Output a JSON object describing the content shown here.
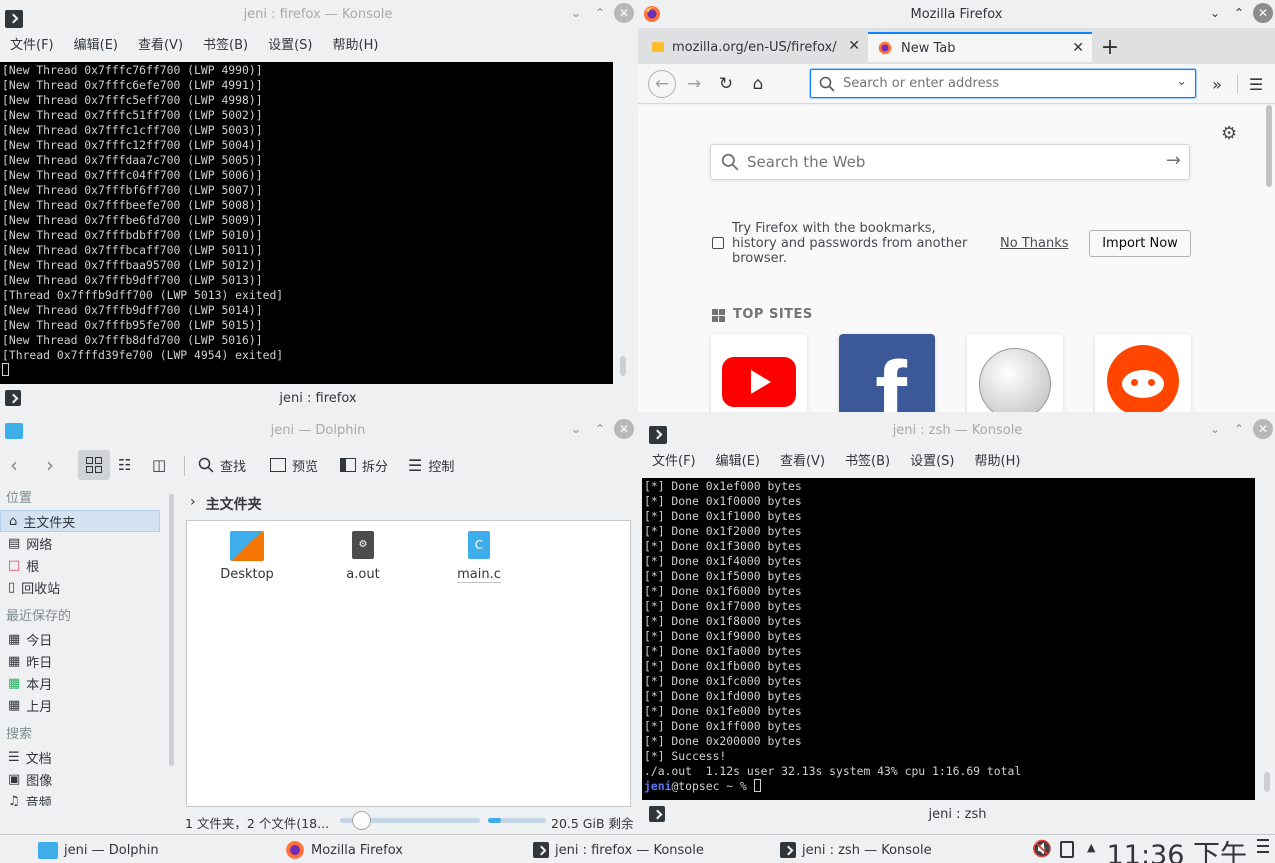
{
  "konsole_top": {
    "title": "jeni : firefox — Konsole",
    "menu": [
      "文件(F)",
      "编辑(E)",
      "查看(V)",
      "书签(B)",
      "设置(S)",
      "帮助(H)"
    ],
    "lines": [
      "[New Thread 0x7fffc76ff700 (LWP 4990)]",
      "[New Thread 0x7fffc6efe700 (LWP 4991)]",
      "[New Thread 0x7fffc5eff700 (LWP 4998)]",
      "[New Thread 0x7fffc51ff700 (LWP 5002)]",
      "[New Thread 0x7fffc1cff700 (LWP 5003)]",
      "[New Thread 0x7fffc12ff700 (LWP 5004)]",
      "[New Thread 0x7fffdaa7c700 (LWP 5005)]",
      "[New Thread 0x7fffc04ff700 (LWP 5006)]",
      "[New Thread 0x7fffbf6ff700 (LWP 5007)]",
      "[New Thread 0x7fffbeefe700 (LWP 5008)]",
      "[New Thread 0x7fffbe6fd700 (LWP 5009)]",
      "[New Thread 0x7fffbdbff700 (LWP 5010)]",
      "[New Thread 0x7fffbcaff700 (LWP 5011)]",
      "[New Thread 0x7fffbaa95700 (LWP 5012)]",
      "[New Thread 0x7fffb9dff700 (LWP 5013)]",
      "[Thread 0x7fffb9dff700 (LWP 5013) exited]",
      "[New Thread 0x7fffb9dff700 (LWP 5014)]",
      "[New Thread 0x7fffb95fe700 (LWP 5015)]",
      "[New Thread 0x7fffb8dfd700 (LWP 5016)]",
      "[Thread 0x7fffd39fe700 (LWP 4954) exited]"
    ],
    "tab_label": "jeni : firefox"
  },
  "firefox": {
    "title": "Mozilla Firefox",
    "tabs": [
      "mozilla.org/en-US/firefox/",
      "New Tab"
    ],
    "url_placeholder": "Search or enter address",
    "web_search_placeholder": "Search the Web",
    "import_text": "Try Firefox with the bookmarks, history and passwords from another browser.",
    "no_thanks": "No Thanks",
    "import_now": "Import Now",
    "top_sites_label": "TOP SITES",
    "top_sites": [
      "youtube",
      "facebook",
      "wikipedia",
      "reddit"
    ]
  },
  "dolphin": {
    "title": "jeni — Dolphin",
    "toolbar": {
      "find": "查找",
      "preview": "预览",
      "split": "拆分",
      "control": "控制"
    },
    "breadcrumb": "主文件夹",
    "places": {
      "header_places": "位置",
      "items_places": [
        "主文件夹",
        "网络",
        "根",
        "回收站"
      ],
      "header_recent": "最近保存的",
      "items_recent": [
        "今日",
        "昨日",
        "本月",
        "上月"
      ],
      "header_search": "搜索",
      "items_search": [
        "文档",
        "图像",
        "音频"
      ]
    },
    "files": [
      "Desktop",
      "a.out",
      "main.c"
    ],
    "status": "1 文件夹，2 个文件(18...",
    "free_space": "20.5 GiB 剩余"
  },
  "konsole_bottom": {
    "title": "jeni : zsh — Konsole",
    "menu": [
      "文件(F)",
      "编辑(E)",
      "查看(V)",
      "书签(B)",
      "设置(S)",
      "帮助(H)"
    ],
    "lines": [
      "[*] Done 0x1ef000 bytes",
      "[*] Done 0x1f0000 bytes",
      "[*] Done 0x1f1000 bytes",
      "[*] Done 0x1f2000 bytes",
      "[*] Done 0x1f3000 bytes",
      "[*] Done 0x1f4000 bytes",
      "[*] Done 0x1f5000 bytes",
      "[*] Done 0x1f6000 bytes",
      "[*] Done 0x1f7000 bytes",
      "[*] Done 0x1f8000 bytes",
      "[*] Done 0x1f9000 bytes",
      "[*] Done 0x1fa000 bytes",
      "[*] Done 0x1fb000 bytes",
      "[*] Done 0x1fc000 bytes",
      "[*] Done 0x1fd000 bytes",
      "[*] Done 0x1fe000 bytes",
      "[*] Done 0x1ff000 bytes",
      "[*] Done 0x200000 bytes",
      "[*] Success!",
      "./a.out  1.12s user 32.13s system 43% cpu 1:16.69 total"
    ],
    "prompt_user": "jeni",
    "prompt_rest": "@topsec ~ % ",
    "tab_label": "jeni : zsh"
  },
  "taskbar": {
    "tasks": [
      "jeni — Dolphin",
      "Mozilla Firefox",
      "jeni : firefox — Konsole",
      "jeni : zsh — Konsole"
    ],
    "clock": "11:36 下午"
  }
}
